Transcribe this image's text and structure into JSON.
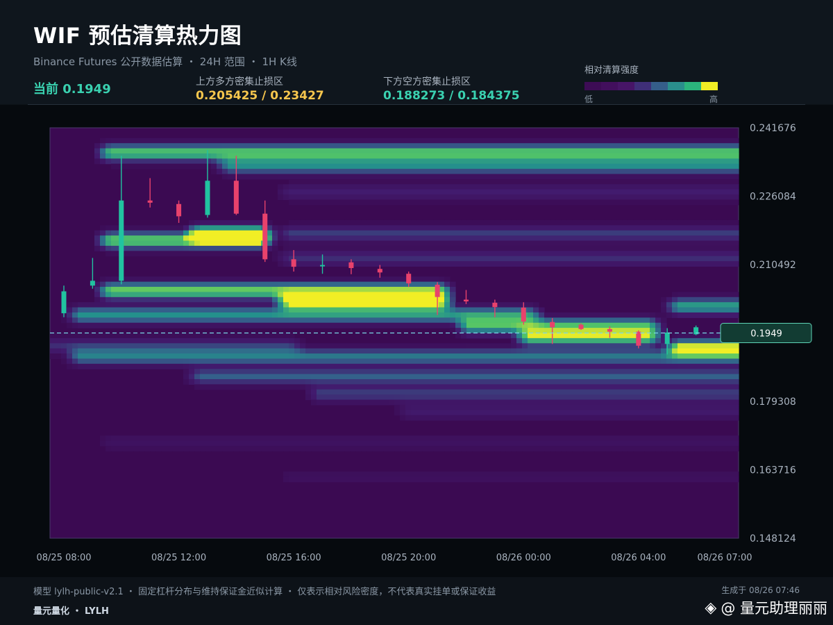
{
  "header": {
    "title": "WIF 预估清算热力图",
    "subtitle": "Binance Futures 公开数据估算 ・ 24H 范围 ・ 1H K线",
    "current": "当前 0.1949",
    "up_zone_label": "上方多方密集止损区",
    "up_zone_values": "0.205425 / 0.23427",
    "down_zone_label": "下方空方密集止损区",
    "down_zone_values": "0.188273 / 0.184375",
    "legend_title": "相对清算强度",
    "legend_low": "低",
    "legend_high": "高"
  },
  "colors": {
    "legend_steps": [
      "#3d0c55",
      "#420f5d",
      "#471567",
      "#3f2f78",
      "#355e8a",
      "#2a8f8c",
      "#2bb57c",
      "#f1ee25"
    ],
    "up_candle": "#21c3a0",
    "down_candle": "#e8426c",
    "price_line": "#7ad6e8",
    "plot_background": "#3b0a52"
  },
  "chart_data": {
    "type": "heatmap",
    "title": "WIF 预估清算热力图",
    "xlabel": "",
    "ylabel": "",
    "x_ticks": [
      "08/25 08:00",
      "08/25 12:00",
      "08/25 16:00",
      "08/25 20:00",
      "08/26 00:00",
      "08/26 04:00",
      "08/26 07:00"
    ],
    "y_ticks": [
      0.241676,
      0.226084,
      0.210492,
      0.179308,
      0.163716,
      0.148124
    ],
    "ylim": [
      0.148124,
      0.241676
    ],
    "current_price": 0.1949,
    "current_price_label": "0.1949",
    "candles": [
      {
        "t": "08/25 08:00",
        "o": 0.1994,
        "h": 0.2057,
        "l": 0.1985,
        "c": 0.2044
      },
      {
        "t": "08/25 09:00",
        "o": 0.2057,
        "h": 0.212,
        "l": 0.205,
        "c": 0.2068
      },
      {
        "t": "08/25 10:00",
        "o": 0.2068,
        "h": 0.2353,
        "l": 0.206,
        "c": 0.2251
      },
      {
        "t": "08/25 11:00",
        "o": 0.2251,
        "h": 0.2302,
        "l": 0.2235,
        "c": 0.2246
      },
      {
        "t": "08/25 12:00",
        "o": 0.2243,
        "h": 0.2251,
        "l": 0.22,
        "c": 0.2215
      },
      {
        "t": "08/25 13:00",
        "o": 0.2218,
        "h": 0.2366,
        "l": 0.2212,
        "c": 0.2296
      },
      {
        "t": "08/25 14:00",
        "o": 0.2296,
        "h": 0.2353,
        "l": 0.2218,
        "c": 0.2221
      },
      {
        "t": "08/25 15:00",
        "o": 0.2221,
        "h": 0.2251,
        "l": 0.2111,
        "c": 0.2117
      },
      {
        "t": "08/25 16:00",
        "o": 0.2117,
        "h": 0.2138,
        "l": 0.2089,
        "c": 0.21
      },
      {
        "t": "08/25 17:00",
        "o": 0.2102,
        "h": 0.2128,
        "l": 0.2084,
        "c": 0.2104
      },
      {
        "t": "08/25 18:00",
        "o": 0.211,
        "h": 0.2117,
        "l": 0.2083,
        "c": 0.2097
      },
      {
        "t": "08/25 19:00",
        "o": 0.2095,
        "h": 0.2104,
        "l": 0.2075,
        "c": 0.2087
      },
      {
        "t": "08/25 20:00",
        "o": 0.2084,
        "h": 0.2089,
        "l": 0.2054,
        "c": 0.2062
      },
      {
        "t": "08/25 21:00",
        "o": 0.2059,
        "h": 0.2065,
        "l": 0.199,
        "c": 0.2031
      },
      {
        "t": "08/25 22:00",
        "o": 0.2025,
        "h": 0.2047,
        "l": 0.2015,
        "c": 0.2021
      },
      {
        "t": "08/25 23:00",
        "o": 0.2018,
        "h": 0.2025,
        "l": 0.1985,
        "c": 0.2008
      },
      {
        "t": "08/26 00:00",
        "o": 0.2007,
        "h": 0.2019,
        "l": 0.1968,
        "c": 0.1975
      },
      {
        "t": "08/26 01:00",
        "o": 0.1974,
        "h": 0.1983,
        "l": 0.1924,
        "c": 0.1962
      },
      {
        "t": "08/26 02:00",
        "o": 0.1968,
        "h": 0.1971,
        "l": 0.1956,
        "c": 0.1958
      },
      {
        "t": "08/26 03:00",
        "o": 0.1958,
        "h": 0.1964,
        "l": 0.1938,
        "c": 0.1952
      },
      {
        "t": "08/26 04:00",
        "o": 0.1952,
        "h": 0.1955,
        "l": 0.1914,
        "c": 0.192
      },
      {
        "t": "08/26 05:00",
        "o": 0.1924,
        "h": 0.196,
        "l": 0.19,
        "c": 0.195
      },
      {
        "t": "08/26 06:00",
        "o": 0.1946,
        "h": 0.1966,
        "l": 0.1944,
        "c": 0.1962
      },
      {
        "t": "08/26 07:00",
        "o": 0.1962,
        "h": 0.197,
        "l": 0.194,
        "c": 0.1946
      }
    ],
    "bands": [
      {
        "price": 0.236,
        "from": "08/25 10:00",
        "to": "08/26 07:00",
        "intensity": 0.8
      },
      {
        "price": 0.233,
        "from": "08/25 14:00",
        "to": "08/26 07:00",
        "intensity": 0.55
      },
      {
        "price": 0.227,
        "from": "08/25 16:00",
        "to": "08/26 07:00",
        "intensity": 0.2
      },
      {
        "price": 0.216,
        "from": "08/25 10:00",
        "to": "08/25 15:00",
        "intensity": 0.85
      },
      {
        "price": 0.2175,
        "from": "08/25 13:00",
        "to": "08/25 15:00",
        "intensity": 1.0
      },
      {
        "price": 0.2175,
        "from": "08/25 16:00",
        "to": "08/26 07:00",
        "intensity": 0.3
      },
      {
        "price": 0.212,
        "from": "08/25 16:00",
        "to": "08/26 07:00",
        "intensity": 0.25
      },
      {
        "price": 0.2045,
        "from": "08/25 10:00",
        "to": "08/25 21:00",
        "intensity": 0.85
      },
      {
        "price": 0.202,
        "from": "08/25 16:00",
        "to": "08/25 21:00",
        "intensity": 1.0
      },
      {
        "price": 0.201,
        "from": "08/26 05:00",
        "to": "08/26 07:00",
        "intensity": 0.65
      },
      {
        "price": 0.199,
        "from": "08/25 09:00",
        "to": "08/26 00:00",
        "intensity": 0.6
      },
      {
        "price": 0.1965,
        "from": "08/25 22:00",
        "to": "08/26 04:00",
        "intensity": 0.7
      },
      {
        "price": 0.194,
        "from": "08/26 00:00",
        "to": "08/26 04:00",
        "intensity": 0.85
      },
      {
        "price": 0.1915,
        "from": "08/26 05:00",
        "to": "08/26 07:00",
        "intensity": 0.95
      },
      {
        "price": 0.192,
        "from": "08/25 08:00",
        "to": "08/25 16:00",
        "intensity": 0.25
      },
      {
        "price": 0.1895,
        "from": "08/25 09:00",
        "to": "08/26 07:00",
        "intensity": 0.5
      },
      {
        "price": 0.185,
        "from": "08/25 13:00",
        "to": "08/26 07:00",
        "intensity": 0.4
      },
      {
        "price": 0.181,
        "from": "08/25 17:00",
        "to": "08/26 07:00",
        "intensity": 0.3
      },
      {
        "price": 0.177,
        "from": "08/25 20:00",
        "to": "08/26 07:00",
        "intensity": 0.18
      },
      {
        "price": 0.17,
        "from": "08/25 10:00",
        "to": "08/26 07:00",
        "intensity": 0.1
      },
      {
        "price": 0.162,
        "from": "08/25 16:00",
        "to": "08/26 07:00",
        "intensity": 0.08
      }
    ]
  },
  "footer": {
    "note": "模型 lylh-public-v2.1 ・ 固定杠杆分布与维持保证金近似计算 ・ 仅表示相对风险密度，不代表真实挂单或保证收益",
    "brand": "量元量化 ・ LYLH",
    "generated": "生成于 08/26 07:46",
    "watermark": "@ 量元助理丽丽"
  }
}
